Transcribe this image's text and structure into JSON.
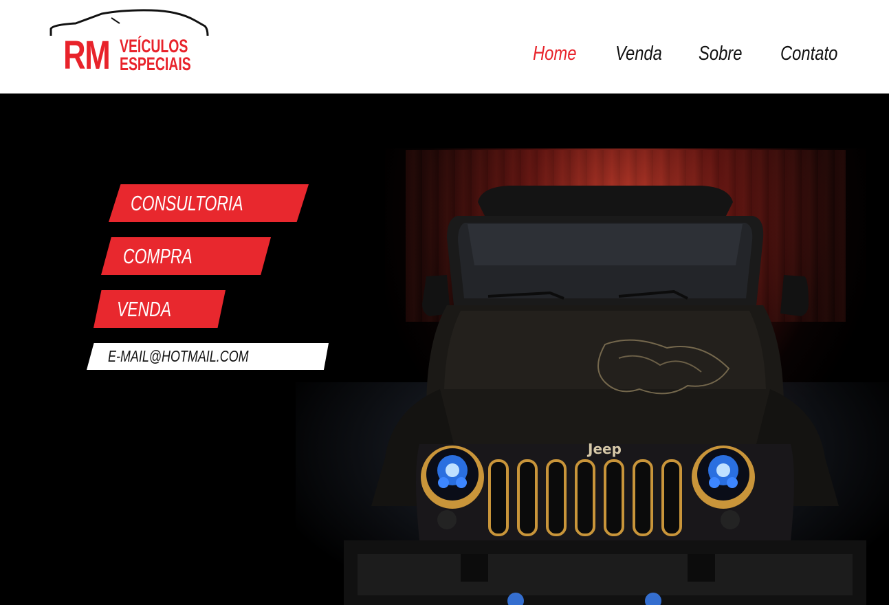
{
  "logo": {
    "rm": "RM",
    "line1": "VEÍCULOS",
    "line2": "ESPECIAIS"
  },
  "nav": {
    "items": [
      {
        "label": "Home",
        "active": true
      },
      {
        "label": "Venda",
        "active": false
      },
      {
        "label": "Sobre",
        "active": false
      },
      {
        "label": "Contato",
        "active": false
      }
    ]
  },
  "hero": {
    "buttons": [
      {
        "label": "CONSULTORIA"
      },
      {
        "label": "COMPRA"
      },
      {
        "label": "VENDA"
      }
    ],
    "email": "E-MAIL@HOTMAIL.COM",
    "vehicle_badge": "Jeep"
  },
  "colors": {
    "accent": "#e8232b",
    "header_bg": "#ffffff",
    "hero_bg": "#000000",
    "nav_text": "#111111"
  }
}
